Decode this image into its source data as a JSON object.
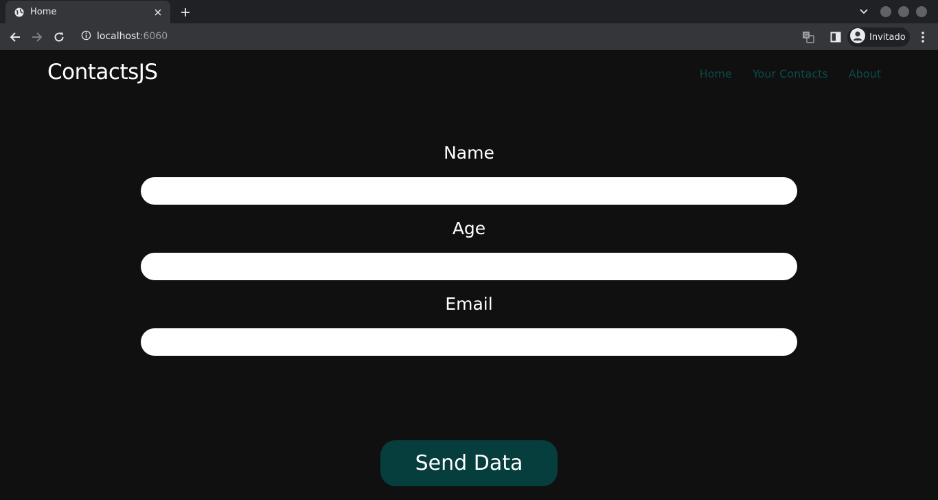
{
  "browser": {
    "tab_title": "Home",
    "url_host": "localhost",
    "url_port": ":6060",
    "profile_name": "Invitado"
  },
  "site": {
    "brand": "ContactsJS",
    "nav": [
      {
        "label": "Home"
      },
      {
        "label": "Your Contacts"
      },
      {
        "label": "About"
      }
    ],
    "nav_color": "#0b4a4a"
  },
  "form": {
    "name_label": "Name",
    "name_value": "",
    "age_label": "Age",
    "age_value": "",
    "email_label": "Email",
    "email_value": "",
    "submit_label": "Send Data",
    "submit_color": "#063d3d"
  }
}
